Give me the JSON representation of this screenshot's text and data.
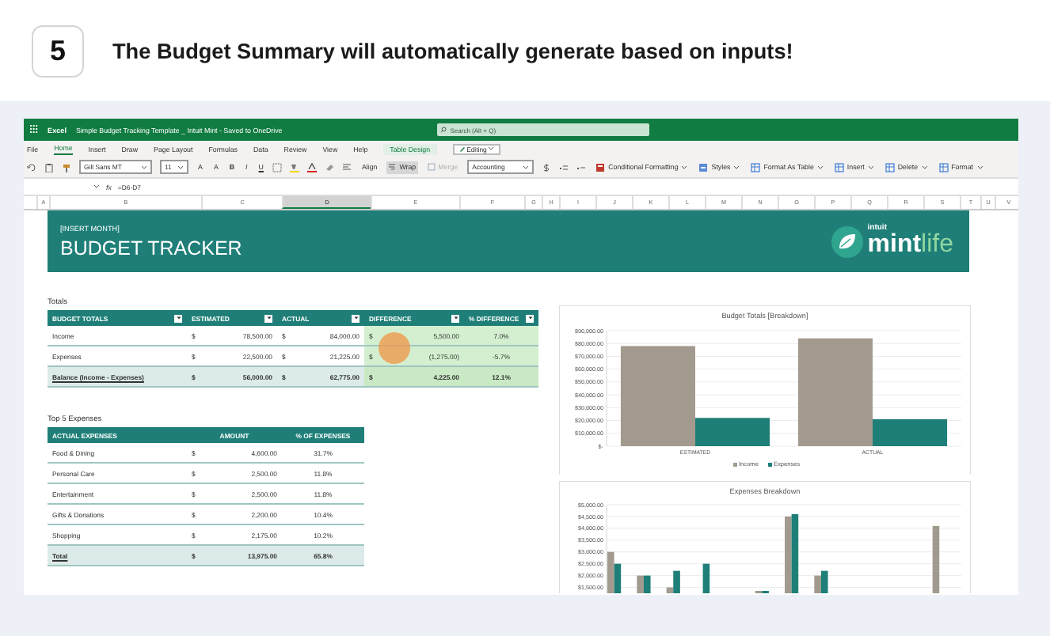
{
  "step": {
    "number": "5",
    "text": "The Budget Summary will automatically generate based on inputs!"
  },
  "app": {
    "name": "Excel",
    "doc_title": "Simple Budget Tracking Template _ Intuit Mint - Saved to OneDrive",
    "search_placeholder": "Search (Alt + Q)"
  },
  "ribbon_tabs": [
    {
      "label": "File",
      "selected": false,
      "kind": "standard"
    },
    {
      "label": "Home",
      "selected": true,
      "kind": "standard"
    },
    {
      "label": "Insert",
      "selected": false,
      "kind": "standard"
    },
    {
      "label": "Draw",
      "selected": false,
      "kind": "standard"
    },
    {
      "label": "Page Layout",
      "selected": false,
      "kind": "standard"
    },
    {
      "label": "Formulas",
      "selected": false,
      "kind": "standard"
    },
    {
      "label": "Data",
      "selected": false,
      "kind": "standard"
    },
    {
      "label": "Review",
      "selected": false,
      "kind": "standard"
    },
    {
      "label": "View",
      "selected": false,
      "kind": "standard"
    },
    {
      "label": "Help",
      "selected": false,
      "kind": "standard"
    },
    {
      "label": "Table Design",
      "selected": false,
      "kind": "contextual"
    }
  ],
  "editing_button": "Editing",
  "toolbar": {
    "font": "Gill Sans MT",
    "size": "11",
    "grow_shrink": [
      "A",
      "A"
    ],
    "format_buttons": [
      "B",
      "I",
      "U"
    ],
    "align": "Align",
    "wrap": {
      "label": "Wrap",
      "on": true
    },
    "merge": {
      "label": "Merge",
      "disabled": true
    },
    "number_format": "Accounting",
    "commands": [
      "Conditional Formatting",
      "Styles",
      "Format As Table",
      "Insert",
      "Delete",
      "Format"
    ]
  },
  "formula_bar": {
    "fx": "fx",
    "formula": "=D6-D7"
  },
  "column_headers": [
    {
      "label": "A",
      "selected": false
    },
    {
      "label": "B",
      "selected": false
    },
    {
      "label": "C",
      "selected": false
    },
    {
      "label": "D",
      "selected": true
    },
    {
      "label": "E",
      "selected": false
    },
    {
      "label": "F",
      "selected": false
    },
    {
      "label": "G",
      "selected": false
    },
    {
      "label": "H",
      "selected": false
    },
    {
      "label": "I",
      "selected": false
    },
    {
      "label": "J",
      "selected": false
    },
    {
      "label": "K",
      "selected": false
    },
    {
      "label": "L",
      "selected": false
    },
    {
      "label": "M",
      "selected": false
    },
    {
      "label": "N",
      "selected": false
    },
    {
      "label": "O",
      "selected": false
    },
    {
      "label": "P",
      "selected": false
    },
    {
      "label": "Q",
      "selected": false
    },
    {
      "label": "R",
      "selected": false
    },
    {
      "label": "S",
      "selected": false
    },
    {
      "label": "T",
      "selected": false
    },
    {
      "label": "U",
      "selected": false
    },
    {
      "label": "V",
      "selected": false
    }
  ],
  "banner": {
    "subtitle": "[INSERT MONTH]",
    "title": "BUDGET TRACKER",
    "logo": {
      "brand": "intuit",
      "name": "mint",
      "suffix": "life"
    }
  },
  "totals": {
    "caption": "Totals",
    "columns": [
      "BUDGET TOTALS",
      "ESTIMATED",
      "ACTUAL",
      "DIFFERENCE",
      "% DIFFERENCE"
    ],
    "rows": [
      {
        "kind": "data",
        "cells": [
          {
            "value": "Income"
          },
          {
            "currency": "$",
            "value": "78,500.00"
          },
          {
            "currency": "$",
            "value": "84,000.00"
          },
          {
            "currency": "$",
            "value": "5,500.00"
          },
          {
            "value": "7.0%"
          }
        ]
      },
      {
        "kind": "data",
        "cells": [
          {
            "value": "Expenses"
          },
          {
            "currency": "$",
            "value": "22,500.00"
          },
          {
            "currency": "$",
            "value": "21,225.00"
          },
          {
            "currency": "$",
            "value": "(1,275.00)"
          },
          {
            "value": "-5.7%"
          }
        ]
      },
      {
        "kind": "total",
        "cells": [
          {
            "value": "Balance (Income - Expenses)"
          },
          {
            "currency": "$",
            "value": "56,000.00"
          },
          {
            "currency": "$",
            "value": "62,775.00"
          },
          {
            "currency": "$",
            "value": "4,225.00"
          },
          {
            "value": "12.1%"
          }
        ]
      }
    ]
  },
  "top_expenses": {
    "caption": "Top 5 Expenses",
    "columns": [
      "ACTUAL EXPENSES",
      "AMOUNT",
      "% OF EXPENSES"
    ],
    "rows": [
      {
        "kind": "data",
        "cells": [
          {
            "value": "Food & Dining"
          },
          {
            "currency": "$",
            "value": "4,600.00"
          },
          {
            "value": "31.7%"
          }
        ]
      },
      {
        "kind": "data",
        "cells": [
          {
            "value": "Personal Care"
          },
          {
            "currency": "$",
            "value": "2,500.00"
          },
          {
            "value": "11.8%"
          }
        ]
      },
      {
        "kind": "data",
        "cells": [
          {
            "value": "Entertainment"
          },
          {
            "currency": "$",
            "value": "2,500.00"
          },
          {
            "value": "11.8%"
          }
        ]
      },
      {
        "kind": "data",
        "cells": [
          {
            "value": "Gifts & Donations"
          },
          {
            "currency": "$",
            "value": "2,200.00"
          },
          {
            "value": "10.4%"
          }
        ]
      },
      {
        "kind": "data",
        "cells": [
          {
            "value": "Shopping"
          },
          {
            "currency": "$",
            "value": "2,175.00"
          },
          {
            "value": "10.2%"
          }
        ]
      },
      {
        "kind": "total",
        "cells": [
          {
            "value": "Total"
          },
          {
            "currency": "$",
            "value": "13,975.00"
          },
          {
            "value": "65.8%"
          }
        ]
      }
    ]
  },
  "charts": [
    {
      "chart_data": {
        "type": "bar",
        "title": "Budget Totals [Breakdown]",
        "categories": [
          "ESTIMATED",
          "ACTUAL"
        ],
        "series": [
          {
            "name": "Income",
            "color": "#a39a8f",
            "values": [
              78000,
              84000
            ]
          },
          {
            "name": "Expenses",
            "color": "#1e7f78",
            "values": [
              22000,
              21000
            ]
          }
        ],
        "grid": true,
        "legend": true,
        "ylim": [
          0,
          90000
        ],
        "yticks": [
          {
            "value": 0,
            "label": "$-"
          },
          {
            "value": 10000,
            "label": "$10,000.00"
          },
          {
            "value": 20000,
            "label": "$20,000.00"
          },
          {
            "value": 30000,
            "label": "$30,000.00"
          },
          {
            "value": 40000,
            "label": "$40,000.00"
          },
          {
            "value": 50000,
            "label": "$50,000.00"
          },
          {
            "value": 60000,
            "label": "$60,000.00"
          },
          {
            "value": 70000,
            "label": "$70,000.00"
          },
          {
            "value": 80000,
            "label": "$80,000.00"
          },
          {
            "value": 90000,
            "label": "$90,000.00"
          }
        ]
      }
    },
    {
      "chart_data": {
        "type": "bar",
        "title": "Expenses Breakdown",
        "series": [
          {
            "color": "#a39a8f",
            "values": [
              3000,
              2000,
              1500,
              null,
              null,
              1350,
              4500,
              2000,
              null,
              null,
              null,
              4100
            ]
          },
          {
            "color": "#1e7f78",
            "values": [
              2500,
              2000,
              2200,
              2500,
              null,
              1350,
              4600,
              2200,
              null,
              null,
              null,
              null
            ]
          }
        ],
        "grid": true,
        "ylim": [
          1250,
          5000
        ],
        "yticks": [
          {
            "value": 1500,
            "label": "$1,500.00"
          },
          {
            "value": 2000,
            "label": "$2,000.00"
          },
          {
            "value": 2500,
            "label": "$2,500.00"
          },
          {
            "value": 3000,
            "label": "$3,000.00"
          },
          {
            "value": 3500,
            "label": "$3,500.00"
          },
          {
            "value": 4000,
            "label": "$4,000.00"
          },
          {
            "value": 4500,
            "label": "$4,500.00"
          },
          {
            "value": 5000,
            "label": "$5,000.00"
          }
        ]
      }
    }
  ]
}
